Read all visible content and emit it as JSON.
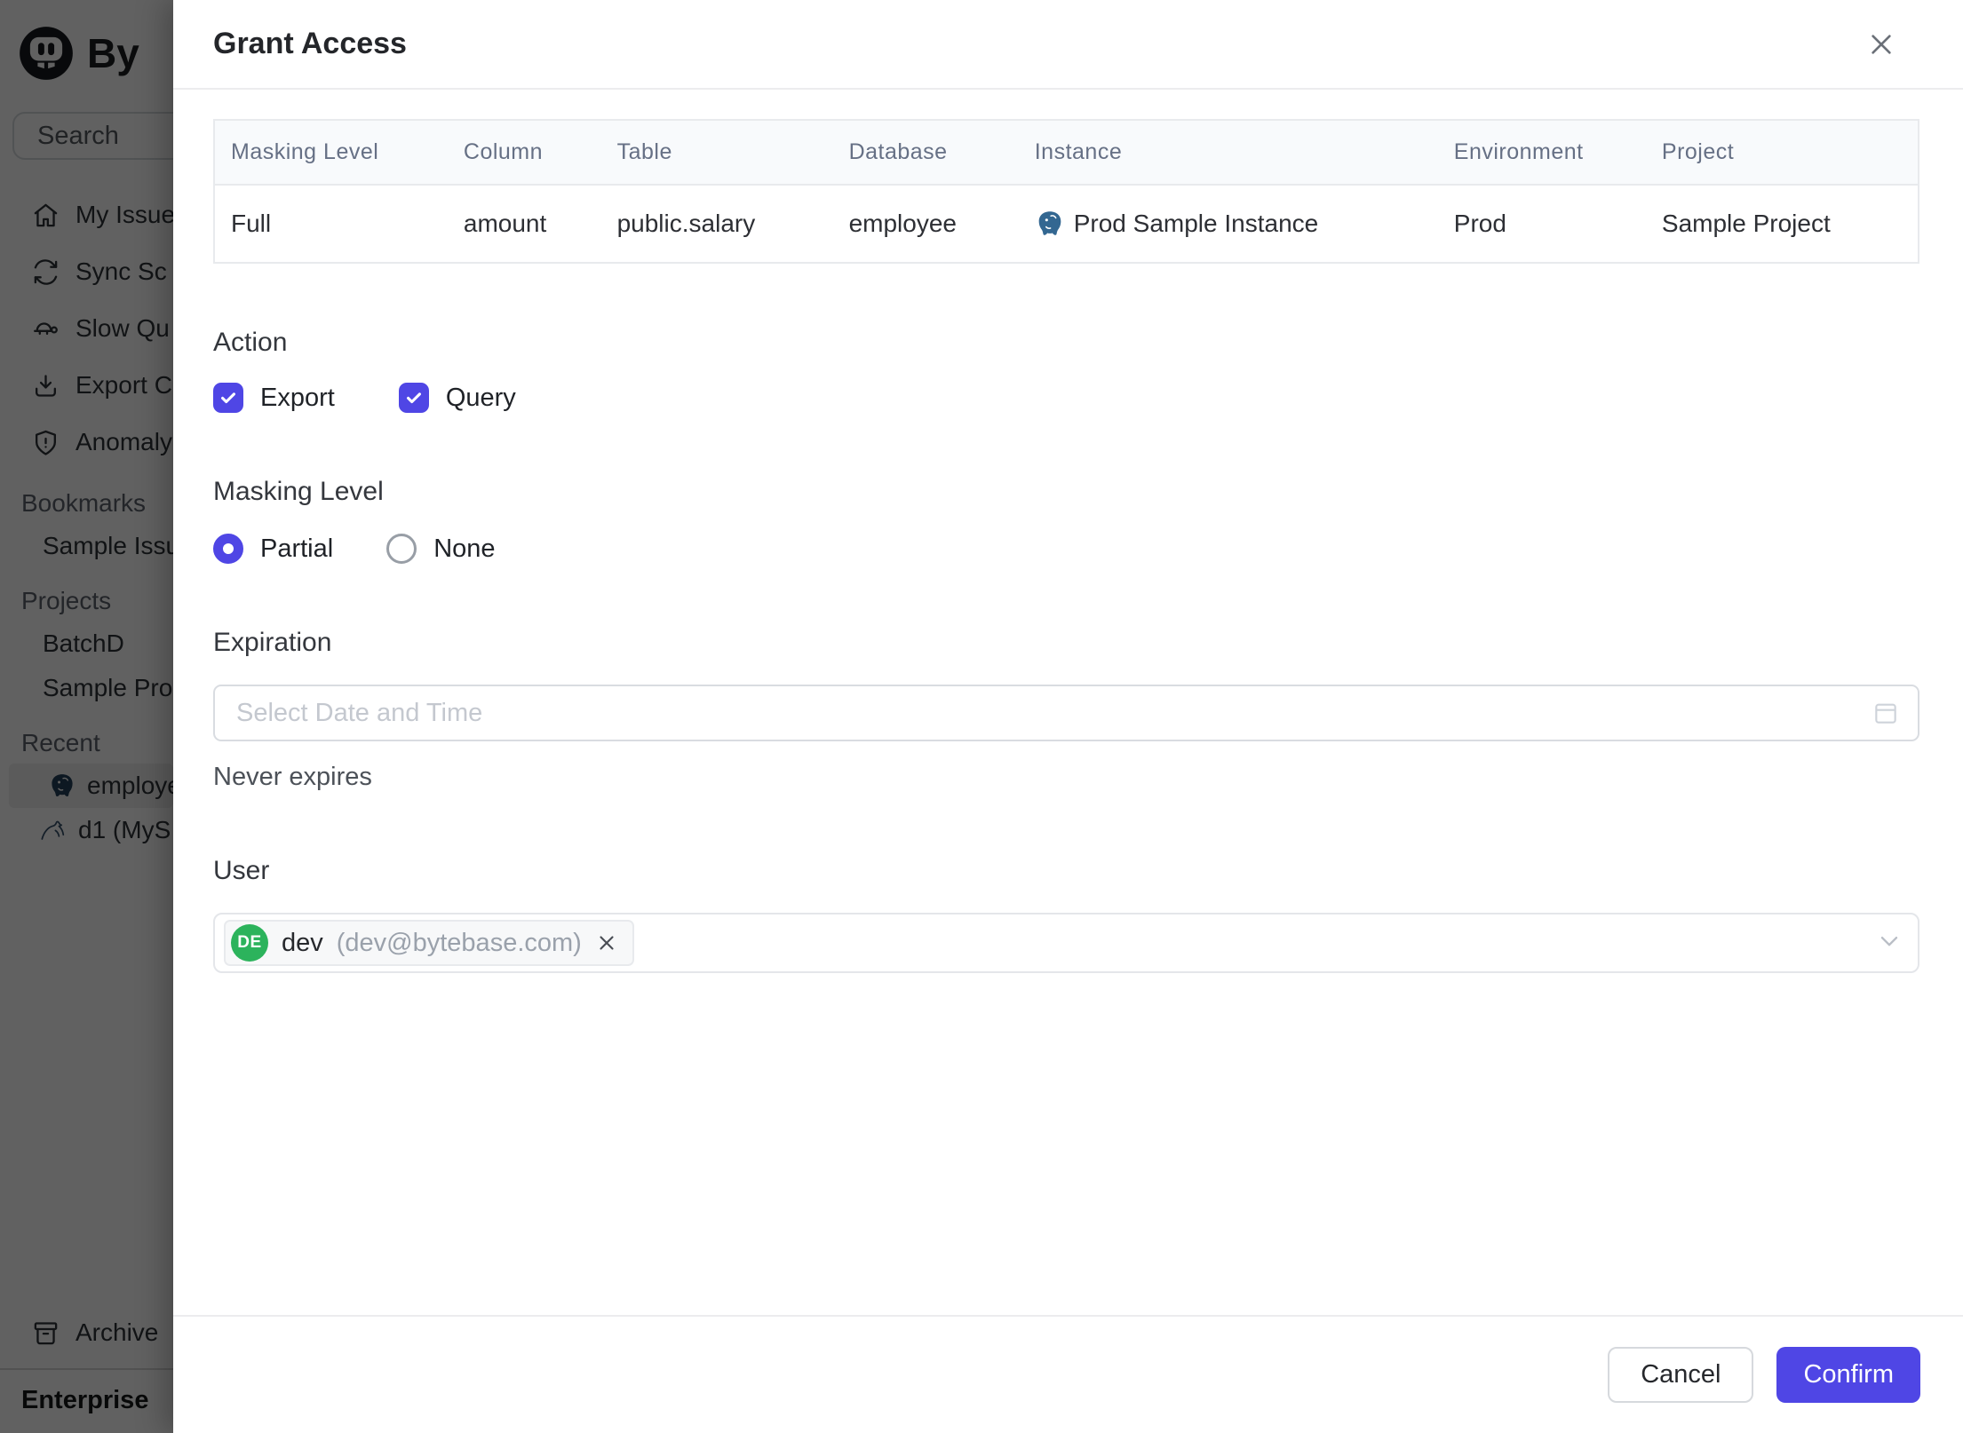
{
  "colors": {
    "accent": "#4f46e5",
    "avatar_green": "#2cb35c",
    "postgres_blue": "#336791"
  },
  "sidebar": {
    "logo_text": "By",
    "search": {
      "placeholder": "Search"
    },
    "nav": [
      {
        "icon": "home-icon",
        "label": "My Issue"
      },
      {
        "icon": "sync-icon",
        "label": "Sync Sc"
      },
      {
        "icon": "turtle-icon",
        "label": "Slow Qu"
      },
      {
        "icon": "download-icon",
        "label": "Export C"
      },
      {
        "icon": "shield-icon",
        "label": "Anomaly"
      }
    ],
    "sections": [
      {
        "label": "Bookmarks",
        "items": [
          {
            "label": "Sample Issu"
          }
        ]
      },
      {
        "label": "Projects",
        "items": [
          {
            "label": "BatchD"
          },
          {
            "label": "Sample Pro"
          }
        ]
      },
      {
        "label": "Recent",
        "items": [
          {
            "icon": "postgres-icon",
            "label": "employe",
            "selected": true
          },
          {
            "icon": "mysql-icon",
            "label": "d1 (MyS"
          }
        ]
      }
    ],
    "archive_label": "Archive",
    "plan_label": "Enterprise"
  },
  "modal": {
    "title": "Grant Access",
    "table": {
      "headers": [
        "Masking Level",
        "Column",
        "Table",
        "Database",
        "Instance",
        "Environment",
        "Project"
      ],
      "row": {
        "masking_level": "Full",
        "column": "amount",
        "table": "public.salary",
        "database": "employee",
        "instance": "Prod Sample Instance",
        "environment": "Prod",
        "project": "Sample Project"
      }
    },
    "action": {
      "heading": "Action",
      "export_label": "Export",
      "query_label": "Query"
    },
    "masking": {
      "heading": "Masking Level",
      "partial_label": "Partial",
      "none_label": "None"
    },
    "expiration": {
      "heading": "Expiration",
      "placeholder": "Select Date and Time",
      "note": "Never expires"
    },
    "user": {
      "heading": "User",
      "chip": {
        "initials": "DE",
        "name": "dev",
        "email": "(dev@bytebase.com)"
      }
    },
    "footer": {
      "cancel_label": "Cancel",
      "confirm_label": "Confirm"
    }
  }
}
